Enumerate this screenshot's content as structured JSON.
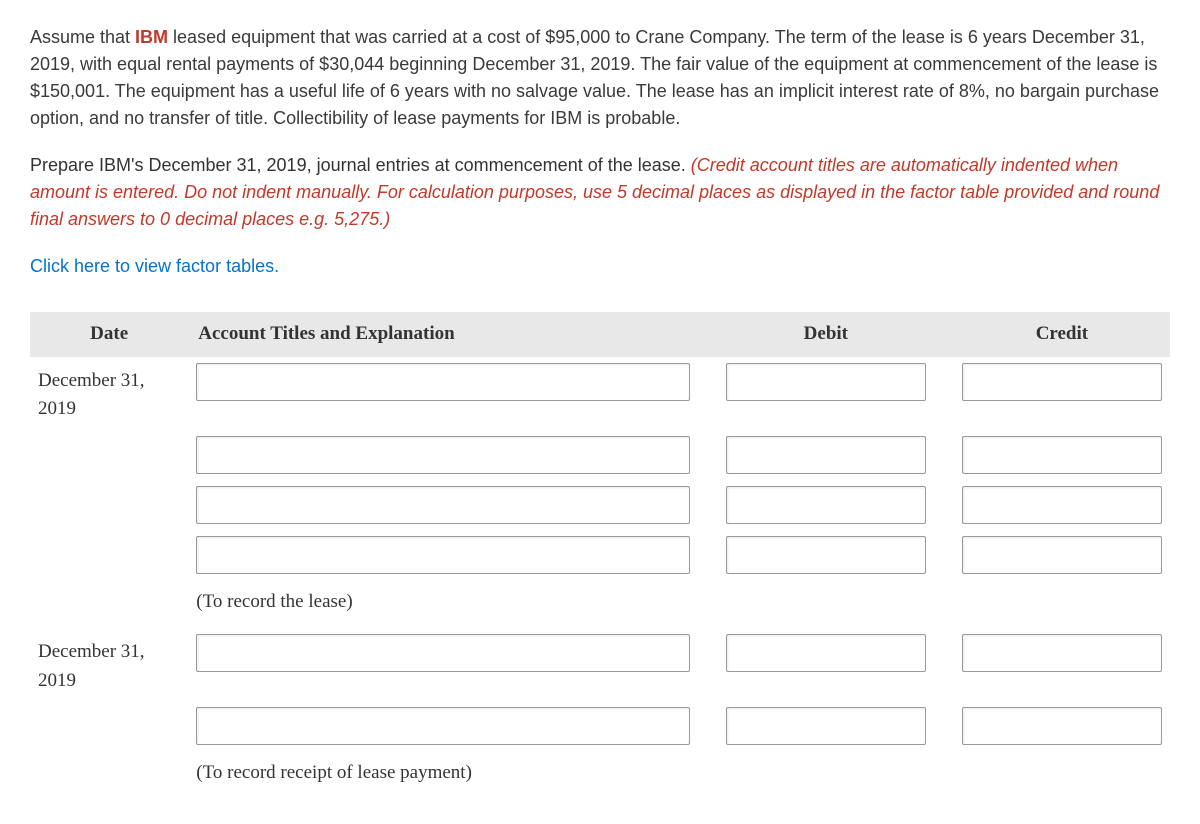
{
  "paragraph1": {
    "prefix": "Assume that ",
    "brand": "IBM",
    "rest": " leased equipment that was carried at a cost of $95,000 to Crane Company. The term of the lease is 6 years December 31, 2019, with equal rental payments of $30,044 beginning December 31, 2019. The fair value of the equipment at commencement of the lease is $150,001. The equipment has a useful life of 6 years with no salvage value. The lease has an implicit interest rate of 8%, no bargain purchase option, and no transfer of title. Collectibility of lease payments for IBM is probable."
  },
  "paragraph2": {
    "lead": "Prepare IBM's December 31, 2019, journal entries at commencement of the lease. ",
    "italic": "(Credit account titles are automatically indented when amount is entered. Do not indent manually. For calculation purposes, use 5 decimal places as displayed in the factor table provided and round final answers to 0 decimal places e.g. 5,275.)"
  },
  "link_text": "Click here to view factor tables.",
  "headers": {
    "date": "Date",
    "account": "Account Titles and Explanation",
    "debit": "Debit",
    "credit": "Credit"
  },
  "rows": {
    "date1": "December 31, 2019",
    "caption1": "(To record the lease)",
    "date2": "December 31, 2019",
    "caption2": "(To record receipt of lease payment)"
  }
}
